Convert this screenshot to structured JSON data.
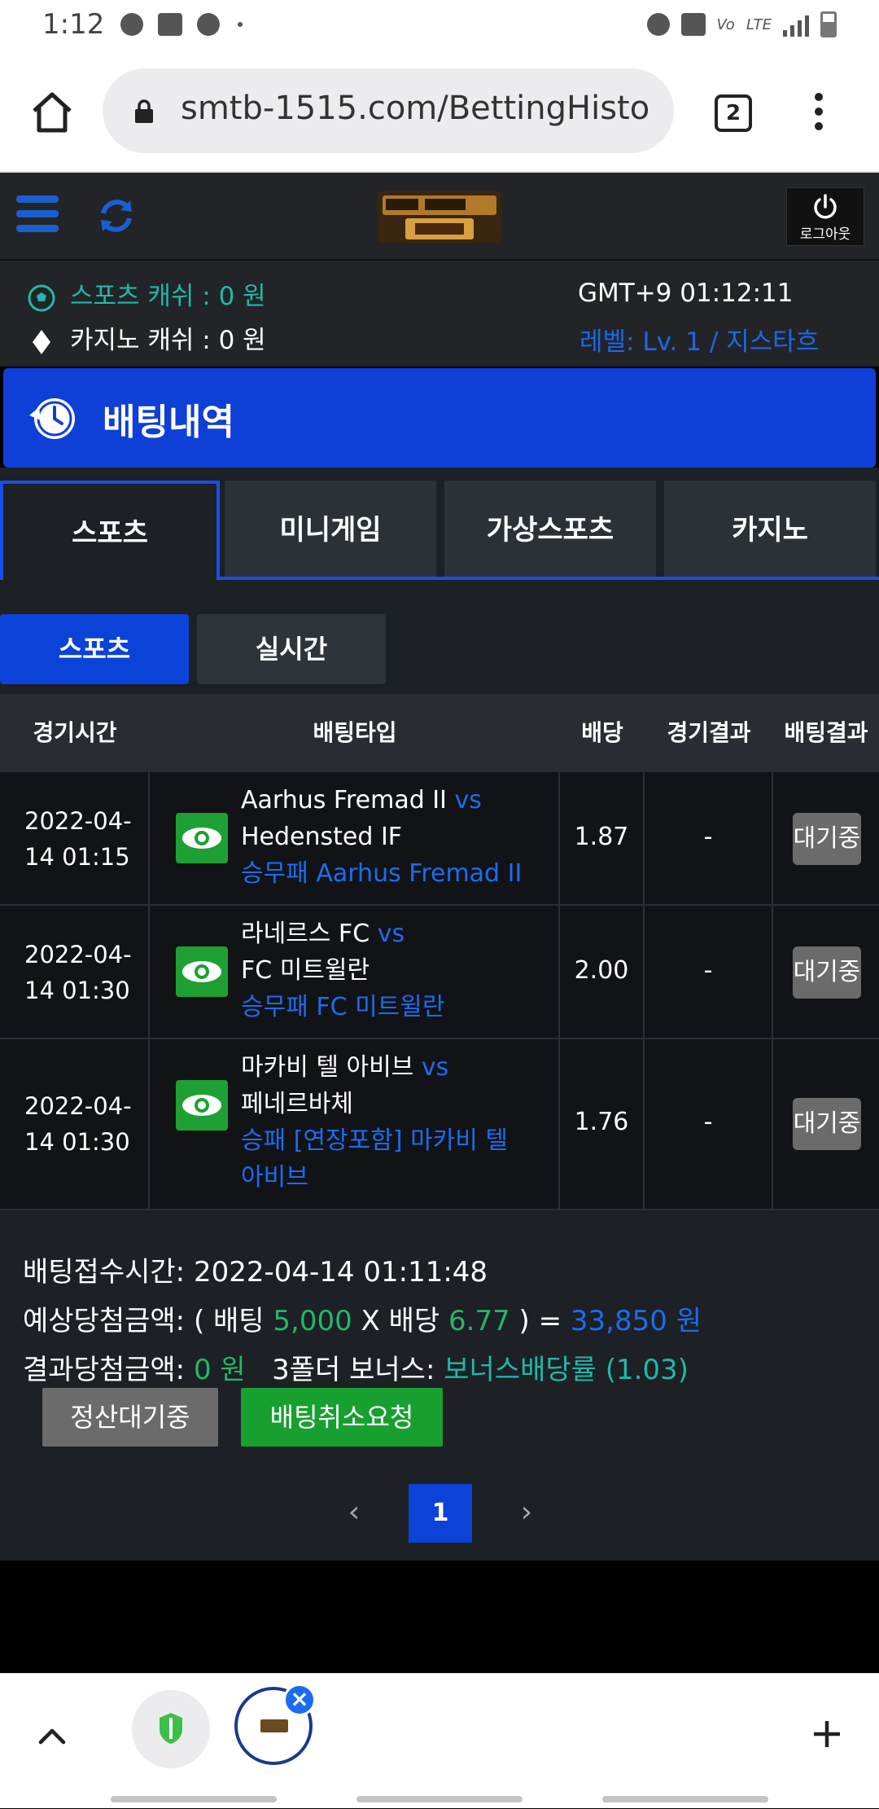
{
  "statusbar": {
    "time": "1:12"
  },
  "browser": {
    "url": "smtb-1515.com/BettingHisto",
    "tab_count": "2"
  },
  "header": {
    "logout_label": "로그아웃"
  },
  "info": {
    "sports_cash": "스포츠 캐쉬 :  0 원",
    "casino_cash": "카지노 캐쉬 :  0 원",
    "gmt": "GMT+9 01:12:11",
    "level": "레벨: Lv. 1 / 지스타흐"
  },
  "page": {
    "title": "배팅내역"
  },
  "tabs": [
    "스포츠",
    "미니게임",
    "가상스포츠",
    "카지노"
  ],
  "subtabs": [
    "스포츠",
    "실시간"
  ],
  "table": {
    "headers": [
      "경기시간",
      "배팅타입",
      "배당",
      "경기결과",
      "배팅결과"
    ],
    "rows": [
      {
        "time1": "2022-04-",
        "time2": "14 01:15",
        "home": "Aarhus Fremad II",
        "vs": "vs",
        "away": "Hedensted IF",
        "pick": "승무패 Aarhus Fremad II",
        "odds": "1.87",
        "result": "-",
        "status": "대기중"
      },
      {
        "time1": "2022-04-",
        "time2": "14 01:30",
        "home": "라네르스 FC",
        "vs": "vs",
        "away": "FC 미트윌란",
        "pick": "승무패 FC 미트윌란",
        "odds": "2.00",
        "result": "-",
        "status": "대기중"
      },
      {
        "time1": "2022-04-",
        "time2": "14 01:30",
        "home": "마카비 텔 아비브",
        "vs": "vs",
        "away": "페네르바체",
        "pick": "승패 [연장포함] 마카비 텔 아비브",
        "odds": "1.76",
        "result": "-",
        "status": "대기중"
      }
    ]
  },
  "summary": {
    "received_label": "배팅접수시간:",
    "received_value": "2022-04-14 01:11:48",
    "expected_label": "예상당첨금액: ( 배팅",
    "bet_amount": "5,000",
    "x_label": "X 배당",
    "total_odds": "6.77",
    "eq_label": ") =",
    "expected_win": "33,850 원",
    "result_label": "결과당첨금액:",
    "result_value": "0 원",
    "bonus_label": "3폴더 보너스:",
    "bonus_value": "보너스배당률 (1.03)",
    "settle_button": "정산대기중",
    "cancel_button": "배팅취소요청"
  },
  "pagination": {
    "prev": "‹",
    "current": "1",
    "next": "›"
  },
  "colors": {
    "accent_blue": "#0b43d8",
    "green": "#17a030",
    "teal": "#20b8a8"
  }
}
